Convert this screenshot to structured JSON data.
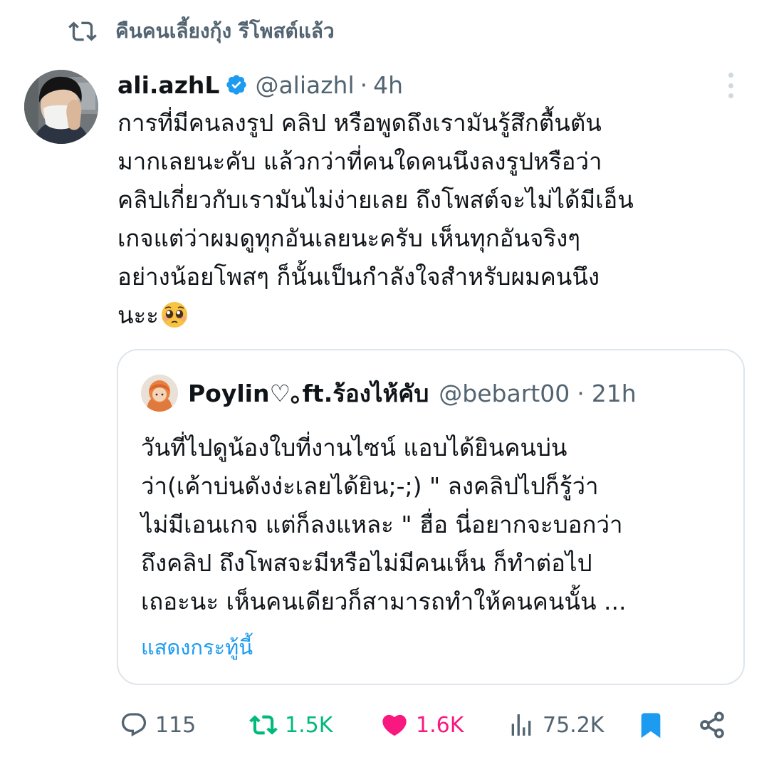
{
  "repost": {
    "text": "คืนคนเลี้ยงกุ้ง รีโพสต์แล้ว",
    "icon": "repost-icon"
  },
  "tweet": {
    "display_name": "ali.azhL",
    "verified": true,
    "handle": "@aliazhl",
    "separator": "·",
    "time": "4h",
    "text_lines": [
      "การที่มีคนลงรูป คลิป หรือพูดถึงเรามันรู้สึกตื้นตัน",
      "มากเลยนะคับ แล้วกว่าที่คนใดคนนึงลงรูปหรือว่า",
      "คลิปเกี่ยวกับเรามันไม่ง่ายเลย ถึงโพสต์จะไม่ได้มีเอ็น",
      "เกจแต่ว่าผมดูทุกอันเลยนะครับ เห็นทุกอันจริงๆ",
      "อย่างน้อยโพสๆ ก็นั้นเป็นกำลังใจสำหรับผมคนนึง",
      "นะะ"
    ],
    "emoji": "pleading-face"
  },
  "quote": {
    "display_name": "Poylin♡｡ft.ร้องไห้คับ",
    "handle": "@bebart00",
    "separator": "·",
    "time": "21h",
    "text_lines": [
      "วันที่ไปดูน้องใบที่งานไซน์ แอบได้ยินคนบ่น",
      "ว่า(เค้าบ่นดังง่ะเลยได้ยิน;-;) \" ลงคลิปไปก็รู้ว่า",
      "ไม่มีเอนเกจ แต่ก็ลงแหละ \" ฮื่อ นี่อยากจะบอกว่า",
      "ถึงคลิป ถึงโพสจะมีหรือไม่มีคนเห็น ก็ทำต่อไป",
      "เถอะนะ เห็นคนเดียวก็สามารถทำให้คนคนนั้น ..."
    ],
    "show_more": "แสดงกระทู้นี้"
  },
  "actions": {
    "reply_count": "115",
    "repost_count": "1.5K",
    "like_count": "1.6K",
    "view_count": "75.2K"
  },
  "colors": {
    "text": "#0f1419",
    "secondary": "#536471",
    "link": "#1d9bf0",
    "repost_active": "#00ba7c",
    "like_active": "#f91880",
    "border": "#dfe5ea"
  }
}
